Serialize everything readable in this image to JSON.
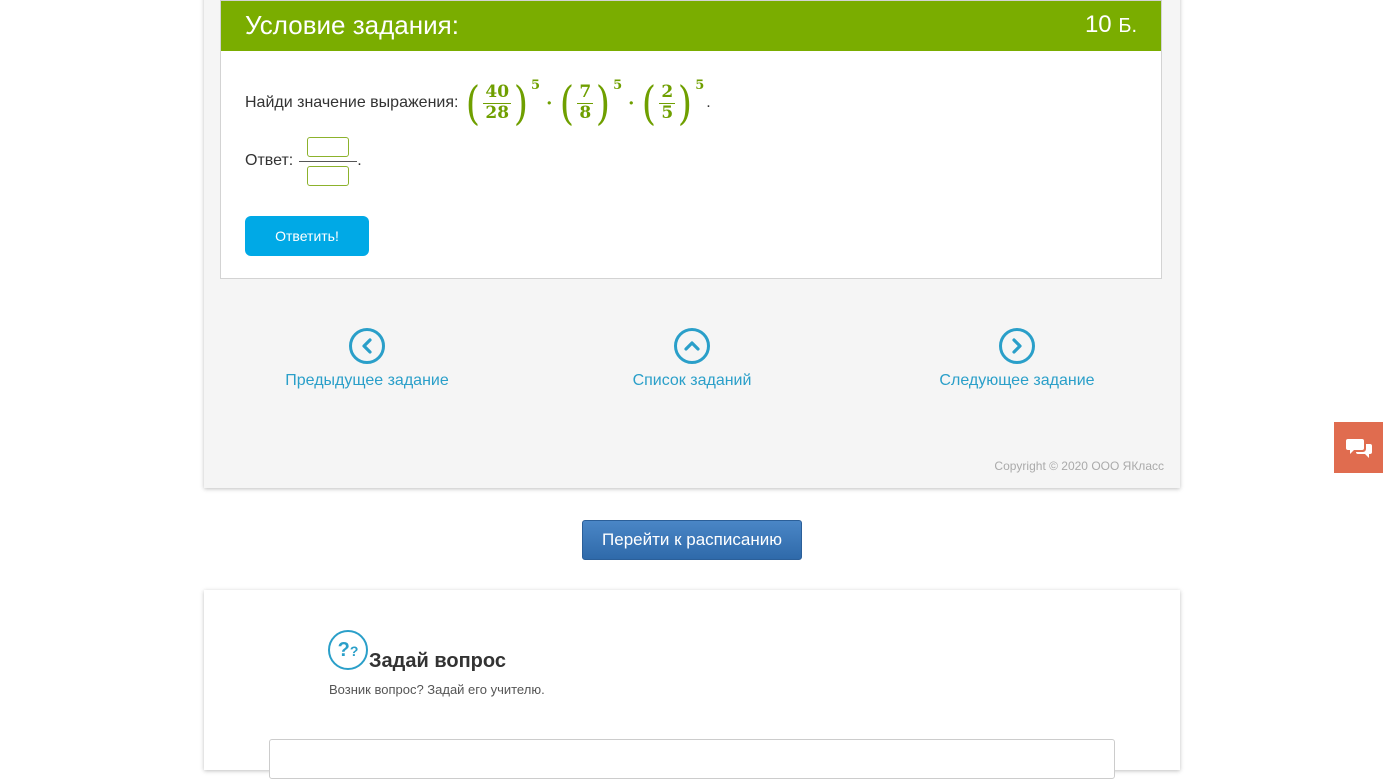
{
  "task": {
    "title": "Условие задания:",
    "points": "10",
    "points_unit": "Б.",
    "prompt": "Найди значение выражения:",
    "expression": [
      {
        "num": "40",
        "den": "28",
        "pow": "5"
      },
      {
        "num": "7",
        "den": "8",
        "pow": "5"
      },
      {
        "num": "2",
        "den": "5",
        "pow": "5"
      }
    ],
    "answer_label": "Ответ:",
    "submit_label": "Ответить!"
  },
  "nav": {
    "prev": "Предыдущее задание",
    "list": "Список заданий",
    "next": "Следующее задание"
  },
  "copyright": "Copyright © 2020 ООО ЯКласс",
  "schedule_button": "Перейти к расписанию",
  "question": {
    "title": "Задай вопрос",
    "subtitle": "Возник вопрос? Задай его учителю."
  },
  "colors": {
    "header_green": "#7aad00",
    "math_green": "#6f9f00",
    "link_blue": "#2a9fc9",
    "submit_blue": "#00a9e6",
    "chat_orange": "#e06c4f"
  }
}
